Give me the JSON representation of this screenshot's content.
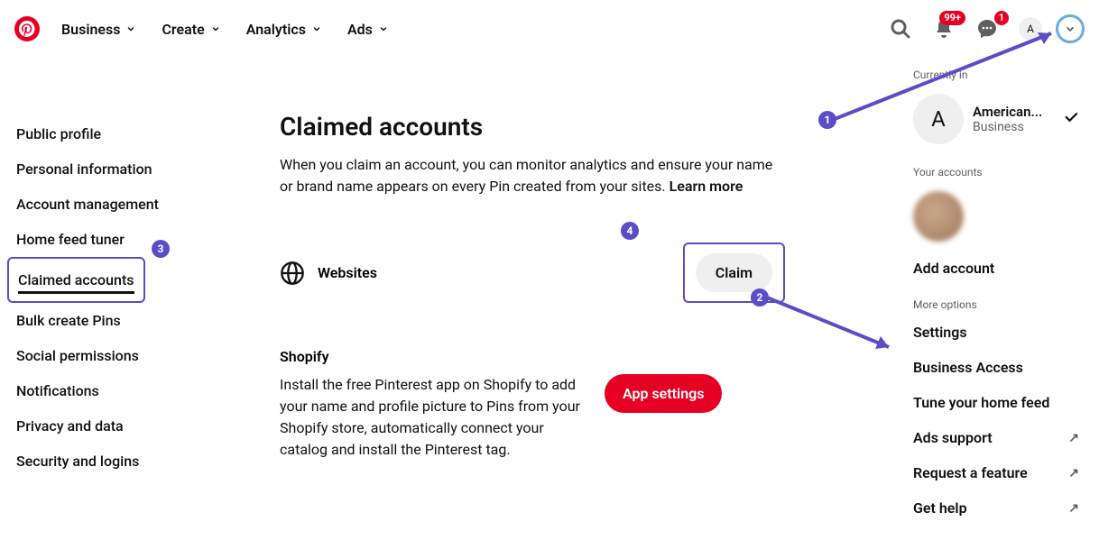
{
  "nav": {
    "items": [
      "Business",
      "Create",
      "Analytics",
      "Ads"
    ],
    "notif_badge": "99+",
    "msg_badge": "1",
    "avatar_letter": "A"
  },
  "sidebar": {
    "items": [
      "Public profile",
      "Personal information",
      "Account management",
      "Home feed tuner",
      "Claimed accounts",
      "Bulk create Pins",
      "Social permissions",
      "Notifications",
      "Privacy and data",
      "Security and logins"
    ]
  },
  "content": {
    "title": "Claimed accounts",
    "desc": "When you claim an account, you can monitor analytics and ensure your name or brand name appears on every Pin created from your sites. ",
    "learn_more": "Learn more",
    "websites_label": "Websites",
    "claim_btn": "Claim",
    "shopify_title": "Shopify",
    "shopify_desc": "Install the free Pinterest app on Shopify to add your name and profile picture to Pins from your Shopify store, automatically connect your catalog and install the Pinterest tag.",
    "app_settings_btn": "App settings"
  },
  "dropdown": {
    "currently_in": "Currently in",
    "acct_name": "American...",
    "acct_type": "Business",
    "acct_letter": "A",
    "your_accounts": "Your accounts",
    "add_account": "Add account",
    "more_options": "More options",
    "items": [
      {
        "label": "Settings",
        "ext": false
      },
      {
        "label": "Business Access",
        "ext": false
      },
      {
        "label": "Tune your home feed",
        "ext": false
      },
      {
        "label": "Ads support",
        "ext": true
      },
      {
        "label": "Request a feature",
        "ext": true
      },
      {
        "label": "Get help",
        "ext": true
      }
    ]
  },
  "annotations": [
    "1",
    "2",
    "3",
    "4"
  ]
}
